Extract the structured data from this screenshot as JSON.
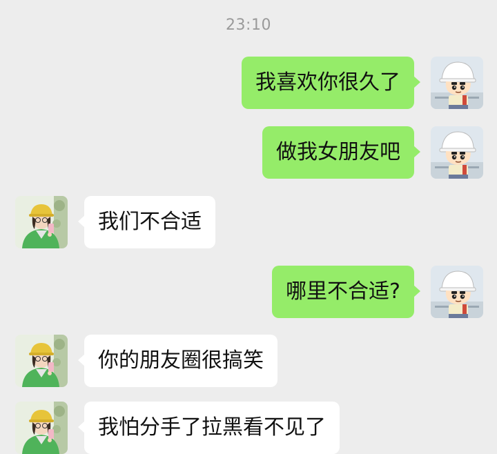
{
  "chat": {
    "timestamp": "23:10",
    "messages": [
      {
        "sender": "me",
        "text": "我喜欢你很久了"
      },
      {
        "sender": "me",
        "text": "做我女朋友吧"
      },
      {
        "sender": "them",
        "text": "我们不合适"
      },
      {
        "sender": "me",
        "text": "哪里不合适?"
      },
      {
        "sender": "them",
        "text": "你的朋友圈很搞笑"
      },
      {
        "sender": "them",
        "text": "我怕分手了拉黑看不见了"
      }
    ]
  },
  "avatars": {
    "me": "shinchan-avatar-icon",
    "them": "girl-green-jacket-avatar-icon"
  },
  "colors": {
    "background": "#ededed",
    "my_bubble": "#95ec69",
    "their_bubble": "#ffffff",
    "timestamp": "#9a9a9a"
  }
}
